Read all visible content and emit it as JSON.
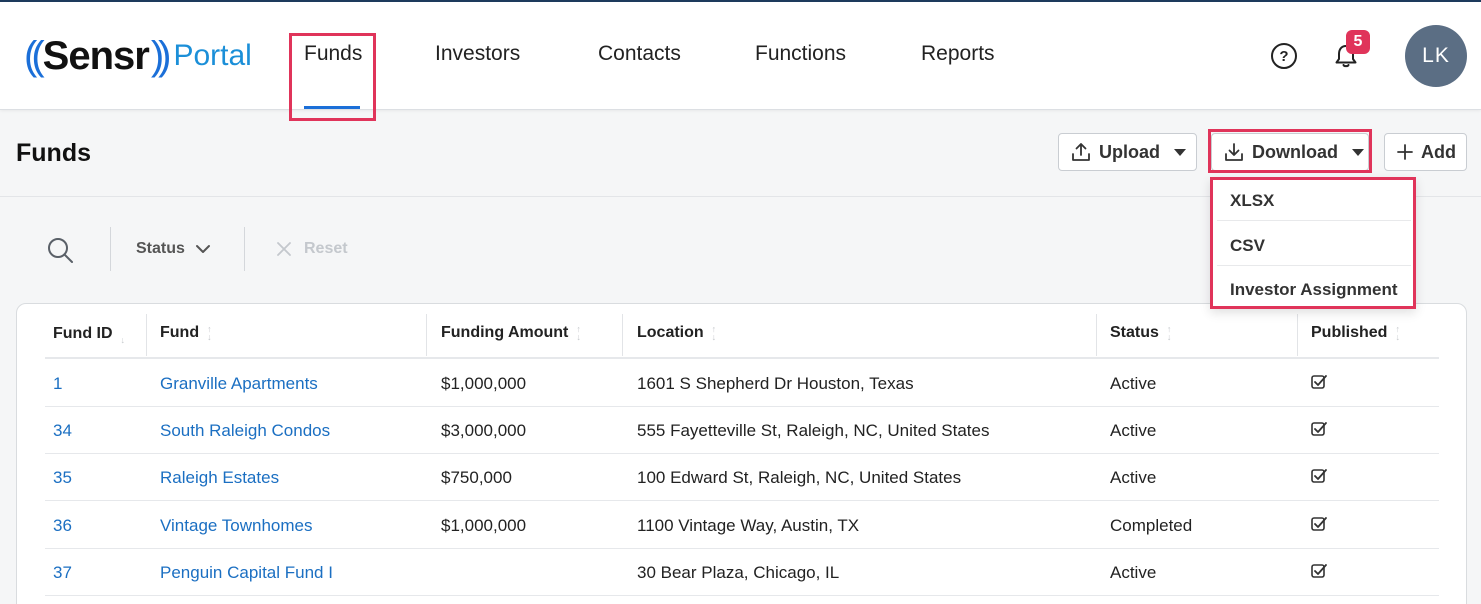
{
  "logo": {
    "brand": "Sensr",
    "product": "Portal"
  },
  "nav": {
    "items": [
      {
        "label": "Funds",
        "active": true
      },
      {
        "label": "Investors"
      },
      {
        "label": "Contacts"
      },
      {
        "label": "Functions"
      },
      {
        "label": "Reports"
      }
    ]
  },
  "header": {
    "notifications_count": "5",
    "avatar_initials": "LK"
  },
  "page": {
    "title": "Funds",
    "upload_label": "Upload",
    "download_label": "Download",
    "add_label": "Add"
  },
  "download_menu": {
    "options": [
      "XLSX",
      "CSV",
      "Investor Assignment"
    ]
  },
  "filters": {
    "status_label": "Status",
    "reset_label": "Reset"
  },
  "table": {
    "columns": [
      "Fund ID",
      "Fund",
      "Funding Amount",
      "Location",
      "Status",
      "Published"
    ],
    "rows": [
      {
        "id": "1",
        "fund": "Granville Apartments",
        "amount": "$1,000,000",
        "location": "1601 S Shepherd Dr Houston, Texas",
        "status": "Active",
        "published": true
      },
      {
        "id": "34",
        "fund": "South Raleigh Condos",
        "amount": "$3,000,000",
        "location": "555 Fayetteville St, Raleigh, NC, United States",
        "status": "Active",
        "published": true
      },
      {
        "id": "35",
        "fund": "Raleigh Estates",
        "amount": "$750,000",
        "location": "100 Edward St, Raleigh, NC, United States",
        "status": "Active",
        "published": true
      },
      {
        "id": "36",
        "fund": "Vintage Townhomes",
        "amount": "$1,000,000",
        "location": "1100 Vintage Way, Austin, TX",
        "status": "Completed",
        "published": true
      },
      {
        "id": "37",
        "fund": "Penguin Capital Fund I",
        "amount": "",
        "location": "30 Bear Plaza, Chicago, IL",
        "status": "Active",
        "published": true
      }
    ]
  },
  "colors": {
    "accent": "#1b6fd8",
    "highlight": "#e0345a",
    "link": "#1b6fc2"
  }
}
